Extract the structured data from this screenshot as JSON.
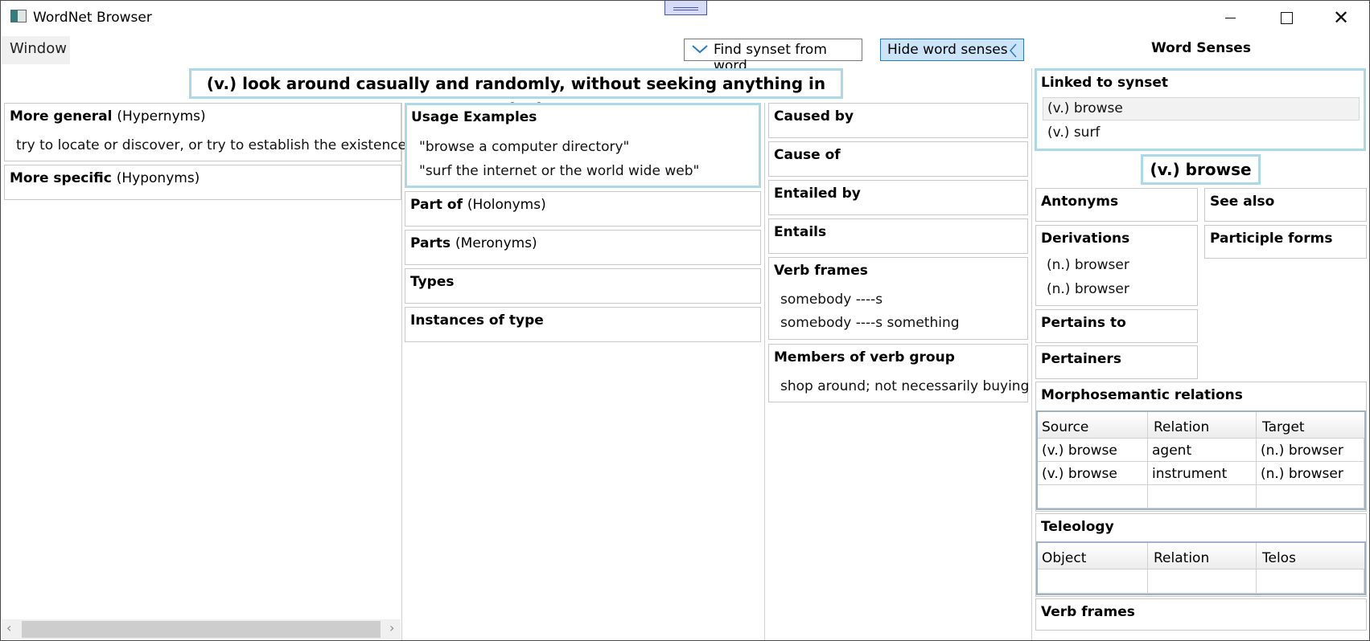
{
  "window": {
    "title": "WordNet Browser"
  },
  "menu": {
    "window_label": "Window"
  },
  "toolbar": {
    "find_label": "Find synset from word",
    "hide_label": "Hide word senses"
  },
  "synset_header": "(v.) look around casually and randomly, without seeking anything in particular",
  "left": {
    "more_general_label": "More general",
    "more_general_sub": "(Hypernyms)",
    "more_general_items": [
      "try to locate or discover, or try to establish the existence of"
    ],
    "more_specific_label": "More specific",
    "more_specific_sub": "(Hyponyms)"
  },
  "middle": {
    "usage_label": "Usage Examples",
    "usage_items": [
      "\"browse a computer directory\"",
      "\"surf the internet or the world wide web\""
    ],
    "part_of_label": "Part of",
    "part_of_sub": "(Holonyms)",
    "parts_label": "Parts",
    "parts_sub": "(Meronyms)",
    "types_label": "Types",
    "instances_label": "Instances of type"
  },
  "right": {
    "caused_by": "Caused by",
    "cause_of": "Cause of",
    "entailed_by": "Entailed by",
    "entails": "Entails",
    "verb_frames_label": "Verb frames",
    "verb_frames": [
      "somebody ----s",
      "somebody ----s something"
    ],
    "members_label": "Members of verb group",
    "members": [
      "shop around; not necessarily buying"
    ]
  },
  "senses": {
    "title": "Word Senses",
    "linked_label": "Linked to synset",
    "linked_items": [
      "(v.) browse",
      "(v.) surf"
    ],
    "sense_header": "(v.) browse",
    "antonyms": "Antonyms",
    "see_also": "See also",
    "derivations_label": "Derivations",
    "derivations": [
      "(n.) browser",
      "(n.) browser"
    ],
    "participle_forms": "Participle forms",
    "pertains_to": "Pertains to",
    "pertainers": "Pertainers",
    "morpho_label": "Morphosemantic relations",
    "morpho_columns": [
      "Source",
      "Relation",
      "Target"
    ],
    "morpho_rows": [
      [
        "(v.) browse",
        "agent",
        "(n.) browser"
      ],
      [
        "(v.) browse",
        "instrument",
        "(n.) browser"
      ]
    ],
    "teleology_label": "Teleology",
    "teleology_columns": [
      "Object",
      "Relation",
      "Telos"
    ],
    "verb_frames_label": "Verb frames"
  }
}
